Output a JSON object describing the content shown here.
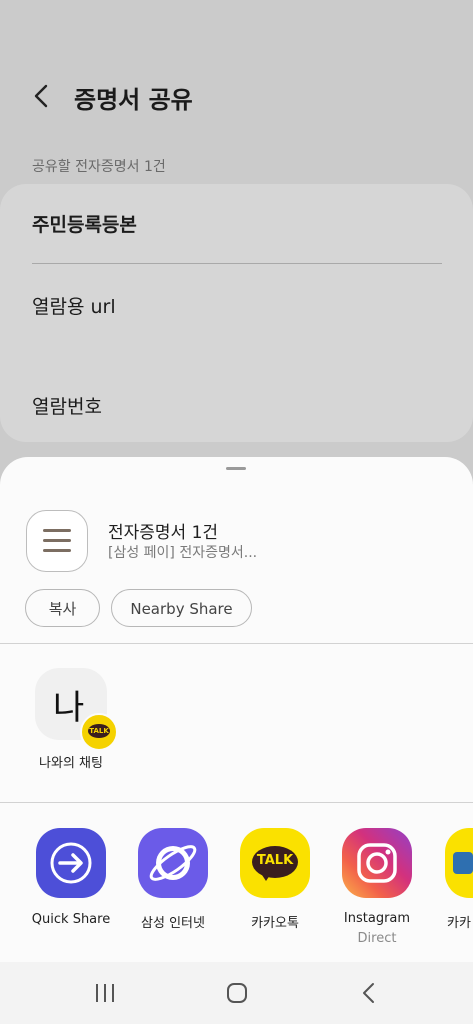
{
  "header": {
    "title": "증명서 공유",
    "back_icon": "chevron-left-icon"
  },
  "section_label": "공유할 전자증명서 1건",
  "card": {
    "document_name": "주민등록등본",
    "options": [
      "열람용 url",
      "열람번호"
    ]
  },
  "share_sheet": {
    "preview_title": "전자증명서 1건",
    "preview_subtitle": "[삼성 페이] 전자증명서...",
    "actions": {
      "copy": "복사",
      "nearby_share": "Nearby Share"
    },
    "direct_share": {
      "label": "나와의 채팅",
      "avatar_text": "나",
      "badge_text": "TALK"
    },
    "apps": [
      {
        "label": "Quick Share",
        "sublabel": ""
      },
      {
        "label": "삼성 인터넷",
        "sublabel": ""
      },
      {
        "label": "카카오톡",
        "sublabel": "",
        "icon_text": "TALK"
      },
      {
        "label": "Instagram",
        "sublabel": "Direct"
      },
      {
        "label": "카카",
        "sublabel": ""
      }
    ]
  },
  "colors": {
    "quick_share": "#4d4fd8",
    "samsung_internet": "#6b5be8",
    "kakao_yellow": "#fae100",
    "instagram": "#d3317d"
  }
}
